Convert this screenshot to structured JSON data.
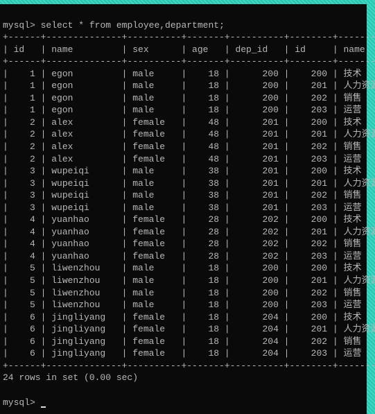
{
  "prompt": "mysql>",
  "command": "select * from employee,department;",
  "columns": [
    "id",
    "name",
    "sex",
    "age",
    "dep_id",
    "id",
    "name"
  ],
  "rows": [
    {
      "id": 1,
      "name": "egon",
      "sex": "male",
      "age": 18,
      "dep_id": 200,
      "did": 200,
      "dname": "技术"
    },
    {
      "id": 1,
      "name": "egon",
      "sex": "male",
      "age": 18,
      "dep_id": 200,
      "did": 201,
      "dname": "人力资源"
    },
    {
      "id": 1,
      "name": "egon",
      "sex": "male",
      "age": 18,
      "dep_id": 200,
      "did": 202,
      "dname": "销售"
    },
    {
      "id": 1,
      "name": "egon",
      "sex": "male",
      "age": 18,
      "dep_id": 200,
      "did": 203,
      "dname": "运营"
    },
    {
      "id": 2,
      "name": "alex",
      "sex": "female",
      "age": 48,
      "dep_id": 201,
      "did": 200,
      "dname": "技术"
    },
    {
      "id": 2,
      "name": "alex",
      "sex": "female",
      "age": 48,
      "dep_id": 201,
      "did": 201,
      "dname": "人力资源"
    },
    {
      "id": 2,
      "name": "alex",
      "sex": "female",
      "age": 48,
      "dep_id": 201,
      "did": 202,
      "dname": "销售"
    },
    {
      "id": 2,
      "name": "alex",
      "sex": "female",
      "age": 48,
      "dep_id": 201,
      "did": 203,
      "dname": "运营"
    },
    {
      "id": 3,
      "name": "wupeiqi",
      "sex": "male",
      "age": 38,
      "dep_id": 201,
      "did": 200,
      "dname": "技术"
    },
    {
      "id": 3,
      "name": "wupeiqi",
      "sex": "male",
      "age": 38,
      "dep_id": 201,
      "did": 201,
      "dname": "人力资源"
    },
    {
      "id": 3,
      "name": "wupeiqi",
      "sex": "male",
      "age": 38,
      "dep_id": 201,
      "did": 202,
      "dname": "销售"
    },
    {
      "id": 3,
      "name": "wupeiqi",
      "sex": "male",
      "age": 38,
      "dep_id": 201,
      "did": 203,
      "dname": "运营"
    },
    {
      "id": 4,
      "name": "yuanhao",
      "sex": "female",
      "age": 28,
      "dep_id": 202,
      "did": 200,
      "dname": "技术"
    },
    {
      "id": 4,
      "name": "yuanhao",
      "sex": "female",
      "age": 28,
      "dep_id": 202,
      "did": 201,
      "dname": "人力资源"
    },
    {
      "id": 4,
      "name": "yuanhao",
      "sex": "female",
      "age": 28,
      "dep_id": 202,
      "did": 202,
      "dname": "销售"
    },
    {
      "id": 4,
      "name": "yuanhao",
      "sex": "female",
      "age": 28,
      "dep_id": 202,
      "did": 203,
      "dname": "运营"
    },
    {
      "id": 5,
      "name": "liwenzhou",
      "sex": "male",
      "age": 18,
      "dep_id": 200,
      "did": 200,
      "dname": "技术"
    },
    {
      "id": 5,
      "name": "liwenzhou",
      "sex": "male",
      "age": 18,
      "dep_id": 200,
      "did": 201,
      "dname": "人力资源"
    },
    {
      "id": 5,
      "name": "liwenzhou",
      "sex": "male",
      "age": 18,
      "dep_id": 200,
      "did": 202,
      "dname": "销售"
    },
    {
      "id": 5,
      "name": "liwenzhou",
      "sex": "male",
      "age": 18,
      "dep_id": 200,
      "did": 203,
      "dname": "运营"
    },
    {
      "id": 6,
      "name": "jingliyang",
      "sex": "female",
      "age": 18,
      "dep_id": 204,
      "did": 200,
      "dname": "技术"
    },
    {
      "id": 6,
      "name": "jingliyang",
      "sex": "female",
      "age": 18,
      "dep_id": 204,
      "did": 201,
      "dname": "人力资源"
    },
    {
      "id": 6,
      "name": "jingliyang",
      "sex": "female",
      "age": 18,
      "dep_id": 204,
      "did": 202,
      "dname": "销售"
    },
    {
      "id": 6,
      "name": "jingliyang",
      "sex": "female",
      "age": 18,
      "dep_id": 204,
      "did": 203,
      "dname": "运营"
    }
  ],
  "footer": "24 rows in set (0.00 sec)",
  "widths": {
    "id": 4,
    "name": 12,
    "sex": 8,
    "age": 5,
    "dep_id": 8,
    "did": 6,
    "dname": 12
  }
}
